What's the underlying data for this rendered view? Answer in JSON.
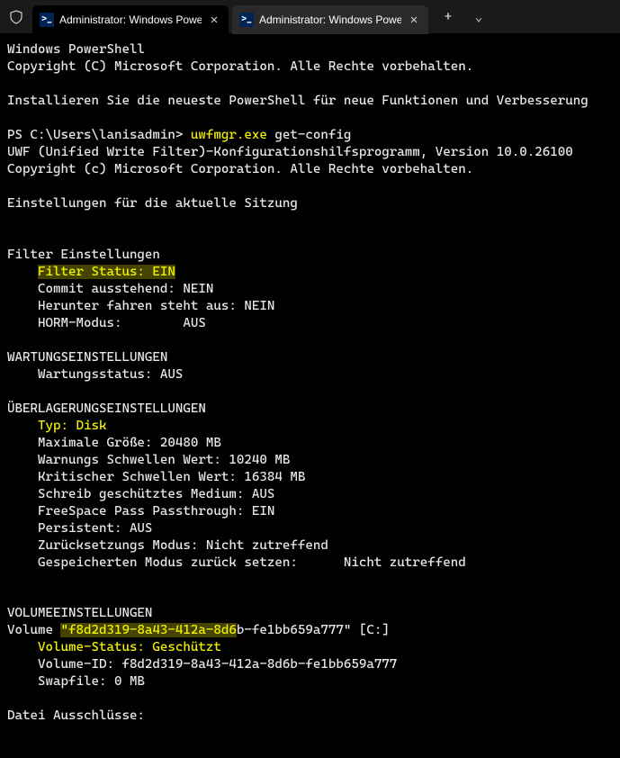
{
  "titlebar": {
    "tabs": [
      {
        "label": "Administrator: Windows Powe"
      },
      {
        "label": "Administrator: Windows Powe"
      }
    ]
  },
  "term": {
    "l01": "Windows PowerShell",
    "l02": "Copyright (C) Microsoft Corporation. Alle Rechte vorbehalten.",
    "l03": "",
    "l04": "Installieren Sie die neueste PowerShell für neue Funktionen und Verbesserung",
    "l05": "",
    "prompt": "PS C:\\Users\\lanisadmin> ",
    "cmd1": "uwfmgr.exe",
    "cmd2": " get-config",
    "l07": "UWF (Unified Write Filter)-Konfigurationshilfsprogramm, Version 10.0.26100",
    "l08": "Copyright (c) Microsoft Corporation. Alle Rechte vorbehalten.",
    "l09": "",
    "l10": "Einstellungen für die aktuelle Sitzung",
    "l11": "",
    "l12": "",
    "l13": "Filter Einstellungen",
    "l14a": "    ",
    "l14b": "Filter Status: EIN",
    "l15": "    Commit ausstehend: NEIN",
    "l16": "    Herunter fahren steht aus: NEIN",
    "l17": "    HORM-Modus:        AUS",
    "l18": "",
    "l19": "WARTUNGSEINSTELLUNGEN",
    "l20": "    Wartungsstatus: AUS",
    "l21": "",
    "l22": "ÜBERLAGERUNGSEINSTELLUNGEN",
    "l23a": "    ",
    "l23b": "Typ: Disk",
    "l24": "    Maximale Größe: 20480 MB",
    "l25": "    Warnungs Schwellen Wert: 10240 MB",
    "l26": "    Kritischer Schwellen Wert: 16384 MB",
    "l27": "    Schreib geschütztes Medium: AUS",
    "l28": "    FreeSpace Pass Passthrough: EIN",
    "l29": "    Persistent: AUS",
    "l30": "    Zurücksetzungs Modus: Nicht zutreffend",
    "l31": "    Gespeicherten Modus zurück setzen:      Nicht zutreffend",
    "l32": "",
    "l33": "",
    "l34": "VOLUMEEINSTELLUNGEN",
    "l35a": "Volume ",
    "l35b": "\"f8d2d319-8a43-412a-8d6",
    "l35c": "b-fe1bb659a777\" [C:]",
    "l36a": "    ",
    "l36b": "Volume-Status: Geschützt",
    "l37": "    Volume-ID: f8d2d319-8a43-412a-8d6b-fe1bb659a777",
    "l38": "    Swapfile: 0 MB",
    "l39": "",
    "l40": "Datei Ausschlüsse:"
  }
}
